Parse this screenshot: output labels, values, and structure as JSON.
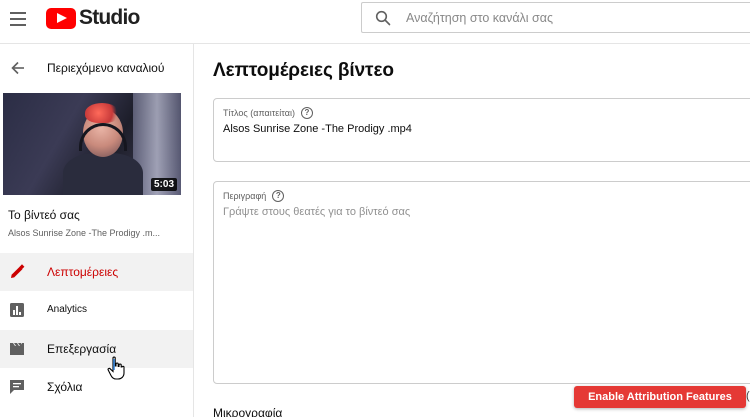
{
  "header": {
    "logo_text": "Studio",
    "search_placeholder": "Αναζήτηση στο κανάλι σας",
    "icons": {
      "menu": "hamburger-menu-icon",
      "search": "search-icon",
      "brand": "youtube-logo"
    },
    "brand_color": "#ff0000"
  },
  "sidebar": {
    "back_label": "Περιεχόμενο καναλιού",
    "thumbnail": {
      "duration": "5:03"
    },
    "your_video_label": "Το βίντεό σας",
    "video_name": "Alsos Sunrise Zone -The Prodigy .m...",
    "items": [
      {
        "label": "Λεπτομέρειες",
        "icon": "pencil-icon",
        "active": true
      },
      {
        "label": "Analytics",
        "icon": "analytics-icon",
        "active": false
      },
      {
        "label": "Επεξεργασία",
        "icon": "clapperboard-icon",
        "active": false
      },
      {
        "label": "Σχόλια",
        "icon": "comment-icon",
        "active": false
      }
    ],
    "active_color": "#cc0000"
  },
  "main": {
    "title": "Λεπτομέρειες βίντεο",
    "title_field": {
      "label": "Τίτλος (απαιτείται)",
      "value": "Alsos Sunrise Zone -The Prodigy .mp4"
    },
    "description_field": {
      "label": "Περιγραφή",
      "placeholder": "Γράψτε στους θεατές για το βίντεό σας"
    },
    "thumbnail_heading": "Μικρογραφία"
  },
  "overlay": {
    "attribution_button": "Enable Attribution Features",
    "attribution_trail": "(",
    "button_color": "#e53935"
  }
}
